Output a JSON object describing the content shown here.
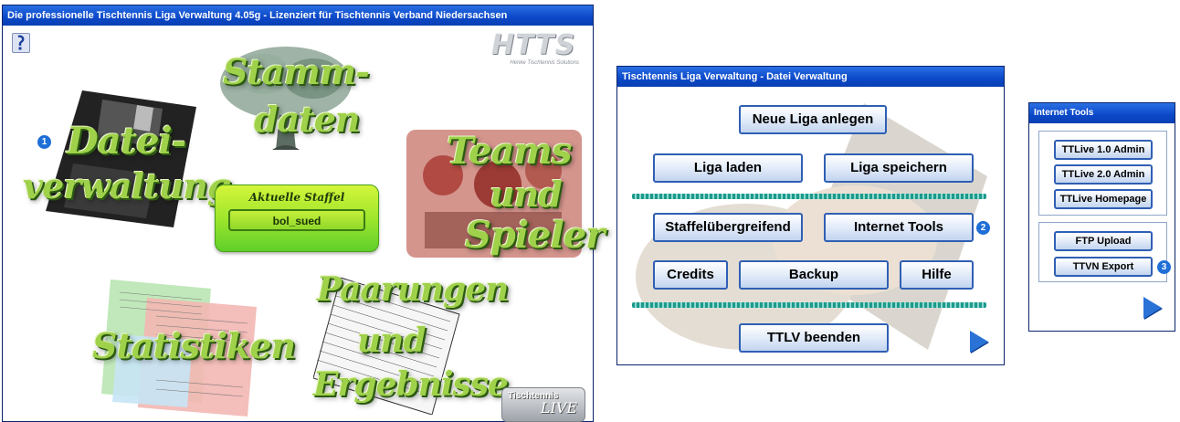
{
  "main_window": {
    "title": "Die professionelle Tischtennis Liga Verwaltung 4.05g - Lizenziert für Tischtennis Verband Niedersachsen",
    "logo_text": "HTTS",
    "logo_sub": "Henke Tischtennis Solutions",
    "modules": {
      "stammdaten_1": "Stamm-",
      "stammdaten_2": "daten",
      "dateiverwaltung_1": "Datei-",
      "dateiverwaltung_2": "verwaltung",
      "teams_1": "Teams",
      "teams_2": "und",
      "teams_3": "Spieler",
      "statistiken": "Statistiken",
      "paarungen_1": "Paarungen",
      "paarungen_2": "und",
      "paarungen_3": "Ergebnisse"
    },
    "staffel_label": "Aktuelle Staffel",
    "staffel_value": "bol_sued",
    "badge": "1",
    "ttlive_1": "Tischtennis",
    "ttlive_2": "LIVE"
  },
  "datei_window": {
    "title": "Tischtennis Liga Verwaltung - Datei Verwaltung",
    "buttons": {
      "neue_liga": "Neue Liga anlegen",
      "liga_laden": "Liga laden",
      "liga_speichern": "Liga speichern",
      "staffel": "Staffelübergreifend",
      "internet_tools": "Internet Tools",
      "credits": "Credits",
      "backup": "Backup",
      "hilfe": "Hilfe",
      "beenden": "TTLV beenden"
    },
    "badge": "2"
  },
  "internet_window": {
    "title": "Internet Tools",
    "buttons": {
      "ttlive1": "TTLive 1.0 Admin",
      "ttlive2": "TTLive 2.0 Admin",
      "homepage": "TTLive Homepage",
      "ftp": "FTP Upload",
      "ttvn": "TTVN Export"
    },
    "badge": "3"
  },
  "colors": {
    "titlebar": "#0b48c8",
    "button_border": "#2f5fb4",
    "script_green": "#9fd14a",
    "badge_blue": "#1f6fd6"
  }
}
